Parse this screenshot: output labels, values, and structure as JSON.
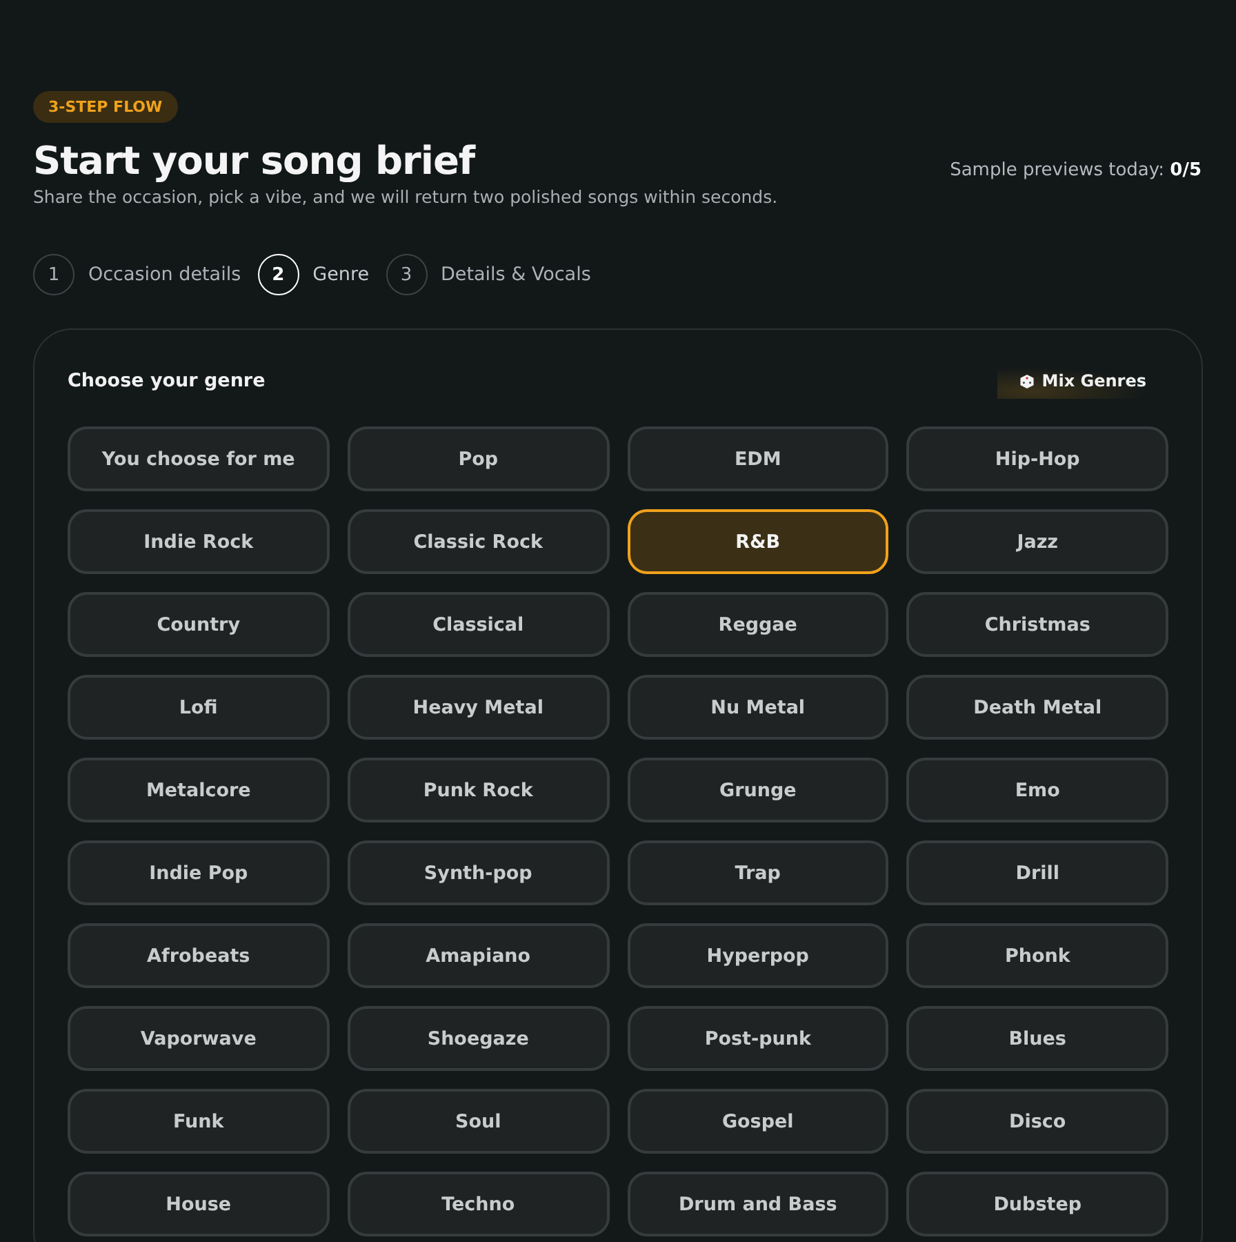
{
  "badge": "3-STEP FLOW",
  "title": "Start your song brief",
  "subtitle": "Share the occasion, pick a vibe, and we will return two polished songs within seconds.",
  "previews": {
    "label": "Sample previews today:",
    "value": "0/5"
  },
  "steps": [
    {
      "number": "1",
      "label": "Occasion details",
      "selected": false
    },
    {
      "number": "2",
      "label": "Genre",
      "selected": true
    },
    {
      "number": "3",
      "label": "Details & Vocals",
      "selected": false
    }
  ],
  "genre_panel": {
    "title": "Choose your genre",
    "mix_button": "Mix Genres",
    "genres": [
      {
        "label": "You choose for me",
        "selected": false
      },
      {
        "label": "Pop",
        "selected": false
      },
      {
        "label": "EDM",
        "selected": false
      },
      {
        "label": "Hip-Hop",
        "selected": false
      },
      {
        "label": "Indie Rock",
        "selected": false
      },
      {
        "label": "Classic Rock",
        "selected": false
      },
      {
        "label": "R&B",
        "selected": true
      },
      {
        "label": "Jazz",
        "selected": false
      },
      {
        "label": "Country",
        "selected": false
      },
      {
        "label": "Classical",
        "selected": false
      },
      {
        "label": "Reggae",
        "selected": false
      },
      {
        "label": "Christmas",
        "selected": false
      },
      {
        "label": "Lofi",
        "selected": false
      },
      {
        "label": "Heavy Metal",
        "selected": false
      },
      {
        "label": "Nu Metal",
        "selected": false
      },
      {
        "label": "Death Metal",
        "selected": false
      },
      {
        "label": "Metalcore",
        "selected": false
      },
      {
        "label": "Punk Rock",
        "selected": false
      },
      {
        "label": "Grunge",
        "selected": false
      },
      {
        "label": "Emo",
        "selected": false
      },
      {
        "label": "Indie Pop",
        "selected": false
      },
      {
        "label": "Synth-pop",
        "selected": false
      },
      {
        "label": "Trap",
        "selected": false
      },
      {
        "label": "Drill",
        "selected": false
      },
      {
        "label": "Afrobeats",
        "selected": false
      },
      {
        "label": "Amapiano",
        "selected": false
      },
      {
        "label": "Hyperpop",
        "selected": false
      },
      {
        "label": "Phonk",
        "selected": false
      },
      {
        "label": "Vaporwave",
        "selected": false
      },
      {
        "label": "Shoegaze",
        "selected": false
      },
      {
        "label": "Post-punk",
        "selected": false
      },
      {
        "label": "Blues",
        "selected": false
      },
      {
        "label": "Funk",
        "selected": false
      },
      {
        "label": "Soul",
        "selected": false
      },
      {
        "label": "Gospel",
        "selected": false
      },
      {
        "label": "Disco",
        "selected": false
      },
      {
        "label": "House",
        "selected": false
      },
      {
        "label": "Techno",
        "selected": false
      },
      {
        "label": "Drum and Bass",
        "selected": false
      },
      {
        "label": "Dubstep",
        "selected": false
      }
    ]
  }
}
